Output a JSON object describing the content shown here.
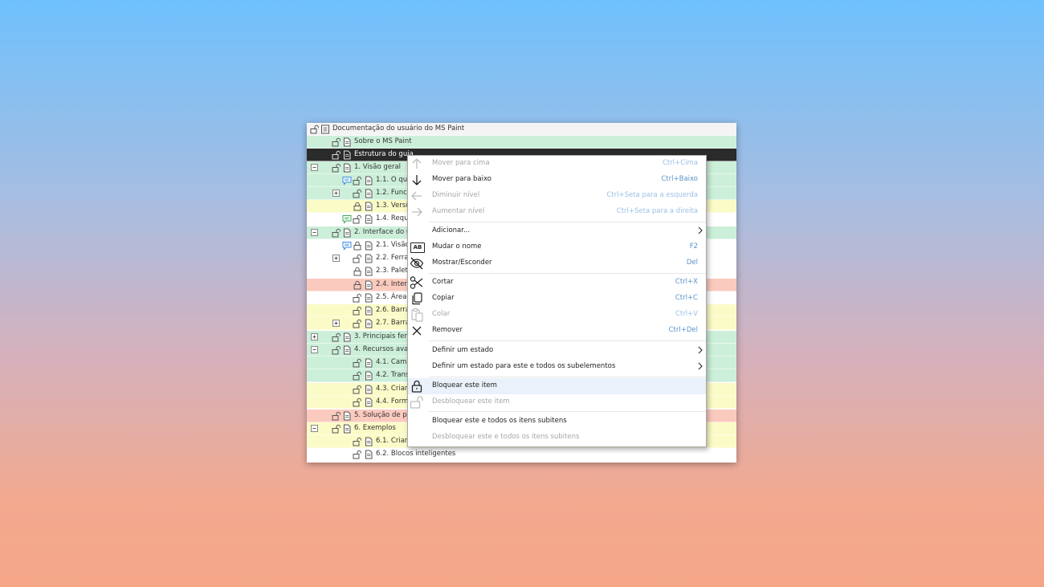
{
  "tree": {
    "root_label": "Documentação do usuário do MS Paint",
    "rows": [
      {
        "label": "Sobre o MS Paint"
      },
      {
        "label": "Estrutura do guia"
      },
      {
        "label": "1. Visão geral"
      },
      {
        "label": "1.1. O que"
      },
      {
        "label": "1.2. Funcio"
      },
      {
        "label": "1.3. Versõ"
      },
      {
        "label": "1.4. Requis"
      },
      {
        "label": "2. Interface do us"
      },
      {
        "label": "2.1. Visão"
      },
      {
        "label": "2.2. Ferrar"
      },
      {
        "label": "2.3. Paleta"
      },
      {
        "label": "2.4. Interf"
      },
      {
        "label": "2.5. Área c"
      },
      {
        "label": "2.6. Barra"
      },
      {
        "label": "2.7. Barra"
      },
      {
        "label": "3. Principais ferra"
      },
      {
        "label": "4. Recursos avan"
      },
      {
        "label": "4.1. Cama"
      },
      {
        "label": "4.2. Trans"
      },
      {
        "label": "4.3. Crian"
      },
      {
        "label": "4.4. Form"
      },
      {
        "label": "5. Solução de pro"
      },
      {
        "label": "6. Exemplos"
      },
      {
        "label": "6.1. Crianc"
      },
      {
        "label": "6.2. Blocos inteligentes"
      }
    ]
  },
  "context_menu": {
    "move_up": {
      "label": "Mover para cima",
      "shortcut": "Ctrl+Cima"
    },
    "move_down": {
      "label": "Mover para baixo",
      "shortcut": "Ctrl+Baixo"
    },
    "decrease_level": {
      "label": "Diminuir nível",
      "shortcut": "Ctrl+Seta para a esquerda"
    },
    "increase_level": {
      "label": "Aumentar nível",
      "shortcut": "Ctrl+Seta para a direita"
    },
    "add": {
      "label": "Adicionar..."
    },
    "rename": {
      "label": "Mudar o nome",
      "shortcut": "F2",
      "icon_text": "AB"
    },
    "show_hide": {
      "label": "Mostrar/Esconder",
      "shortcut": "Del"
    },
    "cut": {
      "label": "Cortar",
      "shortcut": "Ctrl+X"
    },
    "copy": {
      "label": "Copiar",
      "shortcut": "Ctrl+C"
    },
    "paste": {
      "label": "Colar",
      "shortcut": "Ctrl+V"
    },
    "remove": {
      "label": "Remover",
      "shortcut": "Ctrl+Del"
    },
    "set_state": {
      "label": "Definir um estado"
    },
    "set_state_all": {
      "label": "Definir um estado para este e todos os subelementos"
    },
    "lock_item": {
      "label": "Bloquear este item"
    },
    "unlock_item": {
      "label": "Desbloquear este item"
    },
    "lock_all": {
      "label": "Bloquear este e todos os itens subitens"
    },
    "unlock_all": {
      "label": "Desbloquear este e todos os itens subitens"
    }
  },
  "colors": {
    "green": "#ccefd9",
    "yellow": "#fbfbc7",
    "red": "#fbcabe",
    "selected": "#2b2b2b",
    "root": "#f4f4f4",
    "shortcut": "#5a93c9"
  }
}
